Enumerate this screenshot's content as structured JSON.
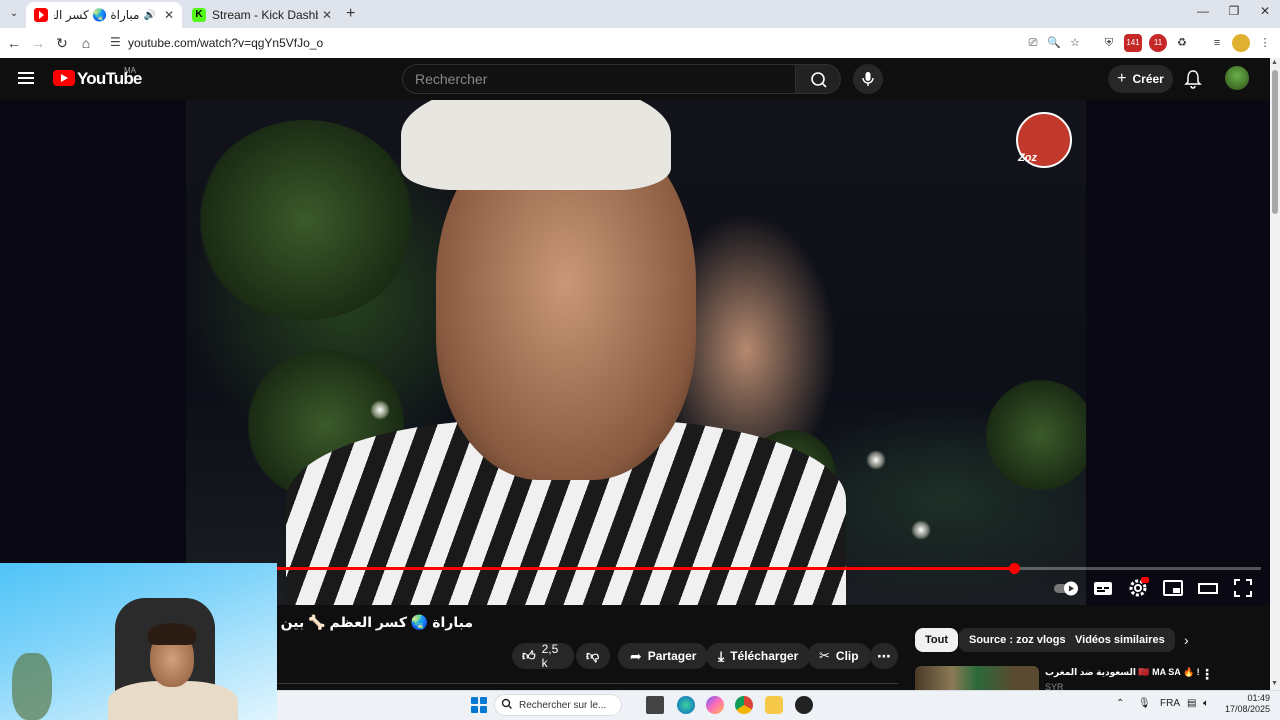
{
  "browser": {
    "tabs": [
      {
        "title": "مباراة 🌏 كسر العظم 🦴 بين",
        "active": true
      },
      {
        "title": "Stream - Kick Dashboard",
        "active": false
      }
    ],
    "url": "youtube.com/watch?v=qgYn5VfJo_o"
  },
  "youtube": {
    "logo_text": "YouTube",
    "country_code": "MA",
    "search_placeholder": "Rechercher",
    "create_label": "Créer"
  },
  "player": {
    "watermark_text": "Zoz",
    "progress_percent": 74.9
  },
  "video": {
    "title": "مباراة 🌏 كسر العظم 🦴 بين الفنانين و ا",
    "likes": "2,5 k",
    "share_label": "Partager",
    "download_label": "Télécharger",
    "clip_label": "Clip"
  },
  "chips": [
    {
      "label": "Tout",
      "active": true
    },
    {
      "label": "Source : zoz vlogs",
      "active": false
    },
    {
      "label": "Vidéos similaires",
      "active": false
    }
  ],
  "recommendation": {
    "title": "السعودية ضد المغرب 🇲🇦 MA SA 🔥 !",
    "channel": "SYR"
  },
  "taskbar": {
    "search_placeholder": "Rechercher sur le...",
    "language": "FRA",
    "time": "01:49",
    "date": "17/08/2025"
  },
  "colors": {
    "accent_red": "#ff0000",
    "kick_green": "#53fc18",
    "yt_bg": "#0f0f0f"
  }
}
